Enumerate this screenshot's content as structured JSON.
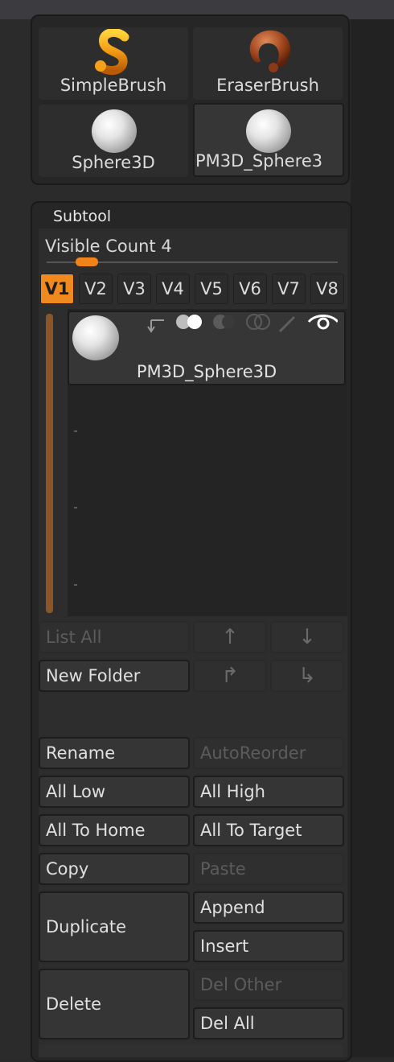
{
  "tools": [
    {
      "label": "SimpleBrush",
      "icon": "simple-brush-icon",
      "selected": false
    },
    {
      "label": "EraserBrush",
      "icon": "eraser-brush-icon",
      "selected": false
    },
    {
      "label": "Sphere3D",
      "icon": "sphere-icon",
      "selected": false
    },
    {
      "label": "PM3D_Sphere3",
      "icon": "sphere-icon",
      "selected": true
    }
  ],
  "subtool": {
    "title": "Subtool",
    "visible_count_label": "Visible Count 4",
    "visible_count_value": 4,
    "visibility_sets": [
      "V1",
      "V2",
      "V3",
      "V4",
      "V5",
      "V6",
      "V7",
      "V8"
    ],
    "active_set": "V1",
    "items": [
      {
        "name": "PM3D_Sphere3D",
        "icons": [
          "arrow-icon",
          "polypaint-toggle-icon",
          "solo-icon",
          "transparency-icon",
          "brush-icon",
          "visibility-eye-icon"
        ]
      }
    ]
  },
  "list_controls": {
    "list_all": "List All",
    "new_folder": "New Folder",
    "move_up": "↑",
    "move_down": "↓",
    "arrow_turn_up": "↱",
    "arrow_turn_down": "↳"
  },
  "actions": {
    "rename": "Rename",
    "auto_reorder": "AutoReorder",
    "all_low": "All Low",
    "all_high": "All High",
    "all_to_home": "All To Home",
    "all_to_target": "All To Target",
    "copy": "Copy",
    "paste": "Paste",
    "duplicate": "Duplicate",
    "append": "Append",
    "insert": "Insert",
    "delete": "Delete",
    "del_other": "Del Other",
    "del_all": "Del All"
  },
  "colors": {
    "accent": "#f08a1e",
    "panel": "#262626",
    "button": "#353535",
    "text": "#e0e0e0",
    "disabled_text": "#5c5c5c"
  }
}
